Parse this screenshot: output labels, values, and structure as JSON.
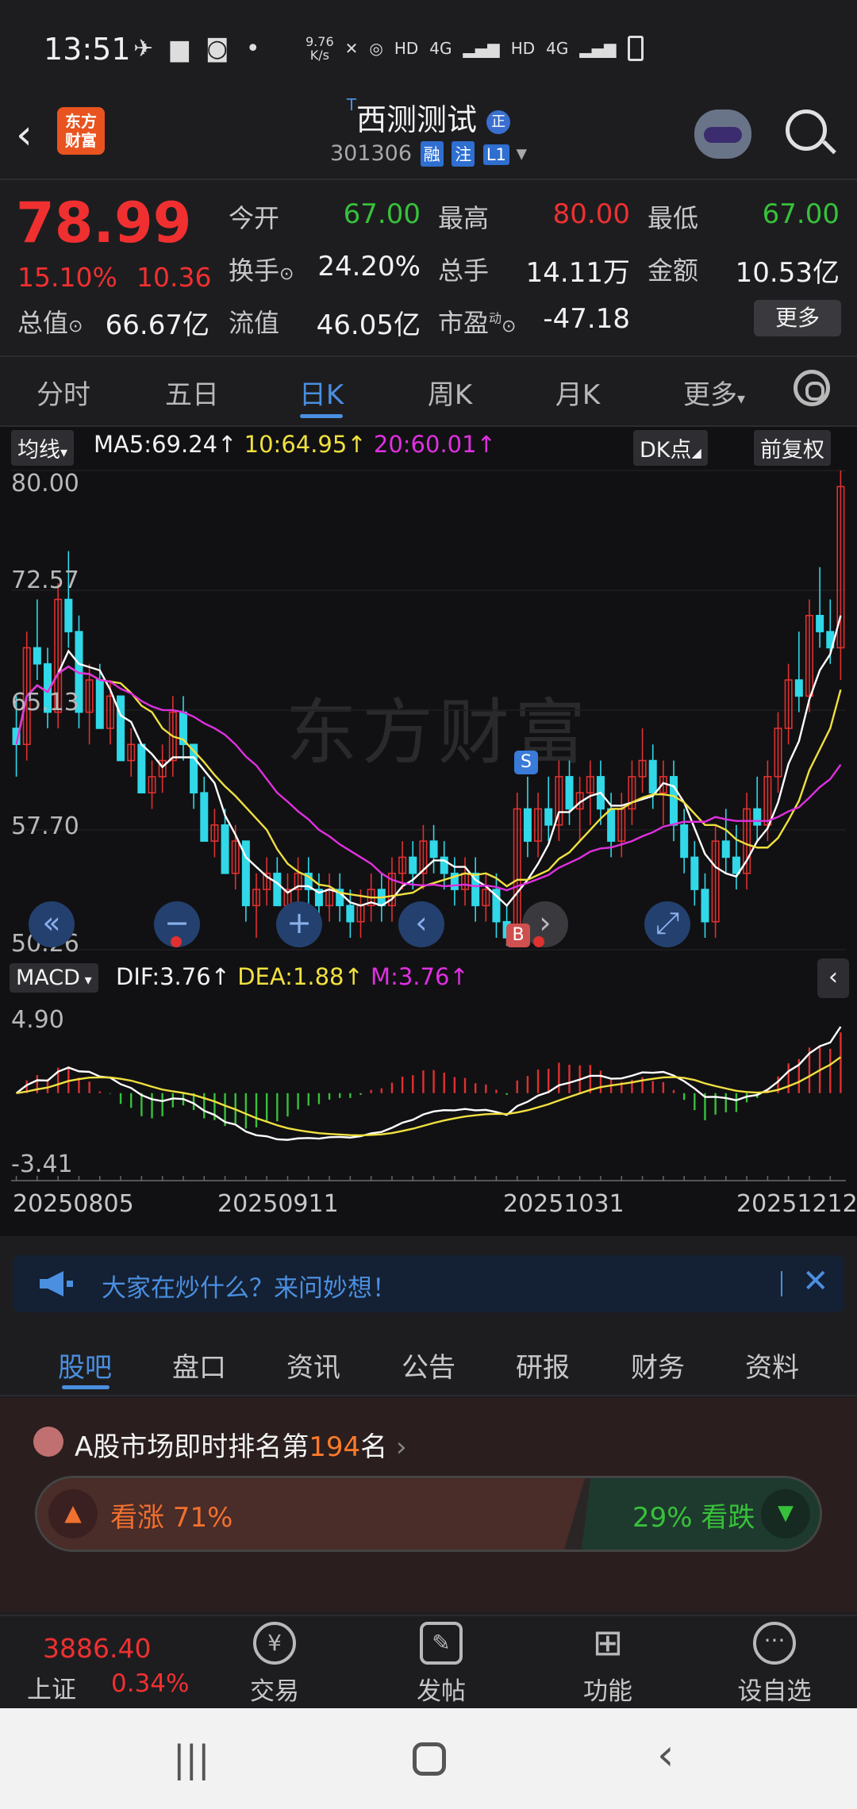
{
  "status_bar": {
    "time": "13:51",
    "net_speed_top": "9.76",
    "net_speed_bottom": "K/s",
    "labels": [
      "HD",
      "4G",
      "HD",
      "4G"
    ]
  },
  "header": {
    "logo_line1": "东方",
    "logo_line2": "财富",
    "t_mark": "T",
    "stock_name": "西测测试",
    "z_badge": "正",
    "code": "301306",
    "tags": [
      "融",
      "注",
      "L1"
    ]
  },
  "quote": {
    "price": "78.99",
    "change_pct": "15.10%",
    "change_amt": "10.36",
    "fields": [
      {
        "label": "今开",
        "value": "67.00",
        "color": "green"
      },
      {
        "label": "最高",
        "value": "80.00",
        "color": "red"
      },
      {
        "label": "最低",
        "value": "67.00",
        "color": "green"
      },
      {
        "label": "换手",
        "value": "24.20%",
        "color": "white"
      },
      {
        "label": "总手",
        "value": "14.11万",
        "color": "white"
      },
      {
        "label": "金额",
        "value": "10.53亿",
        "color": "white"
      },
      {
        "label": "总值",
        "value": "66.67亿",
        "color": "white"
      },
      {
        "label": "流值",
        "value": "46.05亿",
        "color": "white"
      },
      {
        "label": "市盈",
        "value": "-47.18",
        "color": "white"
      }
    ],
    "pe_sup": "动",
    "more_label": "更多"
  },
  "period_tabs": [
    "分时",
    "五日",
    "日K",
    "周K",
    "月K",
    "更多"
  ],
  "chart": {
    "ma_chip": "均线",
    "ma5": "MA5:69.24",
    "ma10": "10:64.95",
    "ma20": "20:60.01",
    "dk_chip": "DK点",
    "adjust_chip": "前复权",
    "watermark": "东方财富",
    "y_labels": [
      "80.00",
      "72.57",
      "65.13",
      "57.70",
      "50.26"
    ],
    "sell_marker": "S",
    "buy_marker": "B",
    "macd_chip": "MACD",
    "dif": "DIF:3.76",
    "dea": "DEA:1.88",
    "m": "M:3.76",
    "macd_y": [
      "4.90",
      "-3.41"
    ],
    "dates": [
      "20250805",
      "20250911",
      "20251031",
      "20251212"
    ],
    "colors": {
      "up": "#e03030",
      "down": "#30d8e8",
      "ma5": "#ffffff",
      "ma10": "#f0e040",
      "ma20": "#e030e0",
      "macd_pos": "#e03030",
      "macd_neg": "#37c13a"
    }
  },
  "chart_data": {
    "type": "candlestick",
    "title": "",
    "xlabel": "",
    "ylabel": "",
    "ylim": [
      50.26,
      80.0
    ],
    "x_ticks": [
      "20250805",
      "20250911",
      "20251031",
      "20251212"
    ],
    "series": [
      {
        "name": "MA5",
        "value_last": 69.24
      },
      {
        "name": "MA10",
        "value_last": 64.95
      },
      {
        "name": "MA20",
        "value_last": 60.01
      }
    ],
    "ohlc": [
      [
        64,
        66,
        61,
        63
      ],
      [
        63,
        70,
        62,
        69
      ],
      [
        69,
        72,
        67,
        68
      ],
      [
        68,
        69,
        64,
        65
      ],
      [
        65,
        73,
        64,
        72
      ],
      [
        72,
        75,
        69,
        70
      ],
      [
        70,
        71,
        64,
        65
      ],
      [
        65,
        68,
        63,
        67
      ],
      [
        67,
        68,
        64,
        64
      ],
      [
        64,
        67,
        63,
        66
      ],
      [
        66,
        66,
        62,
        62
      ],
      [
        62,
        64,
        61,
        63
      ],
      [
        63,
        63,
        60,
        60
      ],
      [
        60,
        62,
        59,
        61
      ],
      [
        61,
        63,
        60,
        62
      ],
      [
        62,
        66,
        61,
        65
      ],
      [
        65,
        66,
        62,
        63
      ],
      [
        63,
        63,
        59,
        60
      ],
      [
        60,
        61,
        57,
        57
      ],
      [
        57,
        59,
        56,
        58
      ],
      [
        58,
        59,
        55,
        55
      ],
      [
        55,
        58,
        54,
        57
      ],
      [
        57,
        57,
        52,
        53
      ],
      [
        53,
        55,
        51,
        54
      ],
      [
        54,
        56,
        53,
        55
      ],
      [
        55,
        56,
        53,
        53
      ],
      [
        53,
        55,
        52,
        54
      ],
      [
        54,
        56,
        53,
        55
      ],
      [
        55,
        56,
        53,
        54
      ],
      [
        54,
        55,
        52,
        53
      ],
      [
        53,
        55,
        52,
        54
      ],
      [
        54,
        55,
        52,
        53
      ],
      [
        53,
        54,
        51,
        52
      ],
      [
        52,
        54,
        51,
        53
      ],
      [
        53,
        55,
        52,
        54
      ],
      [
        54,
        55,
        52,
        53
      ],
      [
        53,
        56,
        52,
        55
      ],
      [
        55,
        57,
        54,
        56
      ],
      [
        56,
        57,
        54,
        55
      ],
      [
        55,
        58,
        54,
        57
      ],
      [
        57,
        58,
        55,
        56
      ],
      [
        56,
        57,
        54,
        55
      ],
      [
        55,
        56,
        53,
        54
      ],
      [
        54,
        56,
        53,
        55
      ],
      [
        55,
        56,
        52,
        53
      ],
      [
        53,
        55,
        52,
        54
      ],
      [
        54,
        55,
        51,
        52
      ],
      [
        52,
        53,
        50.5,
        51
      ],
      [
        51,
        60,
        50.5,
        59
      ],
      [
        59,
        61,
        56,
        57
      ],
      [
        57,
        60,
        56,
        59
      ],
      [
        59,
        61,
        57,
        58
      ],
      [
        58,
        62,
        57,
        61
      ],
      [
        61,
        62,
        58,
        59
      ],
      [
        59,
        61,
        57,
        60
      ],
      [
        60,
        62,
        58,
        61
      ],
      [
        61,
        62,
        58,
        59
      ],
      [
        59,
        60,
        56,
        57
      ],
      [
        57,
        60,
        56,
        59
      ],
      [
        59,
        62,
        58,
        61
      ],
      [
        61,
        64,
        60,
        62
      ],
      [
        62,
        63,
        59,
        60
      ],
      [
        60,
        62,
        58,
        61
      ],
      [
        61,
        62,
        57,
        58
      ],
      [
        58,
        59,
        55,
        56
      ],
      [
        56,
        57,
        53,
        54
      ],
      [
        54,
        55,
        51,
        52
      ],
      [
        52,
        58,
        51,
        57
      ],
      [
        57,
        59,
        55,
        56
      ],
      [
        56,
        58,
        54,
        55
      ],
      [
        55,
        60,
        54,
        59
      ],
      [
        59,
        61,
        57,
        58
      ],
      [
        58,
        62,
        57,
        61
      ],
      [
        61,
        65,
        60,
        64
      ],
      [
        64,
        68,
        63,
        67
      ],
      [
        67,
        70,
        65,
        66
      ],
      [
        66,
        72,
        65,
        71
      ],
      [
        71,
        74,
        69,
        70
      ],
      [
        70,
        72,
        68,
        69
      ],
      [
        69,
        80,
        67,
        79
      ]
    ]
  },
  "banner": {
    "text": "大家在炒什么？来问妙想！"
  },
  "section_tabs": [
    "股吧",
    "盘口",
    "资讯",
    "公告",
    "研报",
    "财务",
    "资料"
  ],
  "rank": {
    "prefix": "A股市场即时排名第",
    "number": "194",
    "suffix": "名"
  },
  "vote": {
    "up_label": "看涨 71%",
    "down_label": "29% 看跌",
    "up_fraction": 0.71
  },
  "bottom_nav": {
    "index_value": "3886.40",
    "index_name": "上证",
    "index_pct": "0.34%",
    "items": [
      {
        "label": "交易",
        "icon": "yuan-icon"
      },
      {
        "label": "发帖",
        "icon": "edit-icon"
      },
      {
        "label": "功能",
        "icon": "grid-icon"
      },
      {
        "label": "设自选",
        "icon": "dots-icon"
      }
    ]
  }
}
